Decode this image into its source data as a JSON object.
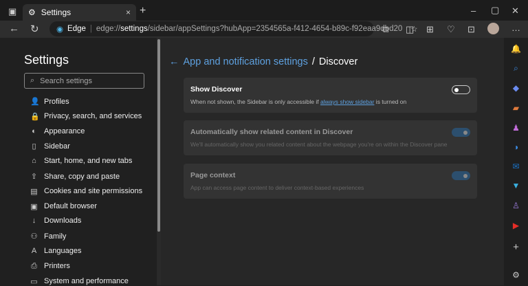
{
  "tab": {
    "title": "Settings",
    "close": "×",
    "new": "+"
  },
  "window": {
    "minimize": "–",
    "maximize": "▢",
    "close": "✕"
  },
  "address": {
    "brand": "Edge",
    "prefix": "edge://",
    "bold": "settings",
    "rest": "/sidebar/appSettings?hubApp=2354565a-f412-4654-b89c-f92eaa9dbd20"
  },
  "nav": {
    "title": "Settings",
    "search_placeholder": "Search settings",
    "items": [
      {
        "label": "Profiles",
        "icon": "👤"
      },
      {
        "label": "Privacy, search, and services",
        "icon": "🔒"
      },
      {
        "label": "Appearance",
        "icon": "◐"
      },
      {
        "label": "Sidebar",
        "icon": "▯"
      },
      {
        "label": "Start, home, and new tabs",
        "icon": "⌂"
      },
      {
        "label": "Share, copy and paste",
        "icon": "⇪"
      },
      {
        "label": "Cookies and site permissions",
        "icon": "▤"
      },
      {
        "label": "Default browser",
        "icon": "▣"
      },
      {
        "label": "Downloads",
        "icon": "↓"
      },
      {
        "label": "Family",
        "icon": "⚇"
      },
      {
        "label": "Languages",
        "icon": "A"
      },
      {
        "label": "Printers",
        "icon": "⎙"
      },
      {
        "label": "System and performance",
        "icon": "▭"
      }
    ]
  },
  "breadcrumb": {
    "back": "←",
    "parent": "App and notification settings",
    "sep": "/",
    "current": "Discover"
  },
  "cards": [
    {
      "title": "Show Discover",
      "desc_before": "When not shown, the Sidebar is only accessible if ",
      "link": "always show sidebar",
      "desc_after": " is turned on",
      "on": false
    },
    {
      "title": "Automatically show related content in Discover",
      "desc": "We'll automatically show you related content about the webpage you're on within the Discover pane",
      "on": true
    },
    {
      "title": "Page context",
      "desc": "App can access page content to deliver context-based experiences",
      "on": true
    }
  ],
  "colors": {
    "accent": "#5ea1e0",
    "toggle_on": "#2c4f6e"
  }
}
